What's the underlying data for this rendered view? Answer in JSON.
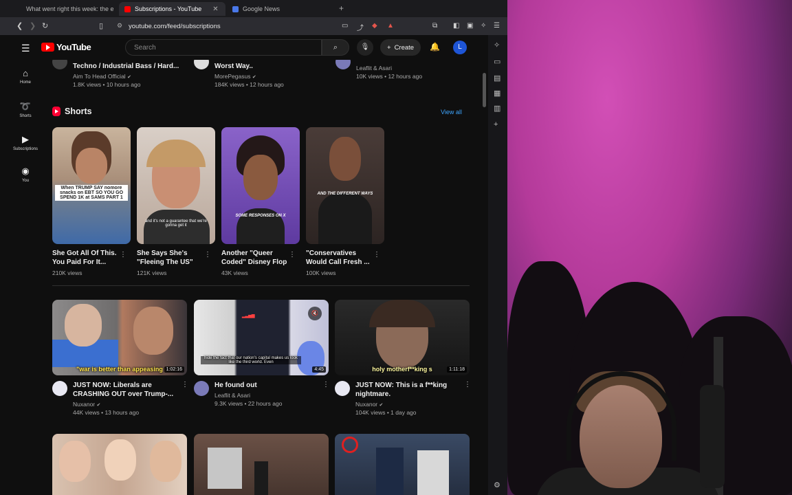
{
  "tabs": [
    {
      "label": "What went right this week: the e",
      "active": false
    },
    {
      "label": "Subscriptions - YouTube",
      "active": true
    },
    {
      "label": "Google News",
      "active": false
    }
  ],
  "address": {
    "url": "youtube.com/feed/subscriptions"
  },
  "youtube": {
    "logo_text": "YouTube",
    "search_placeholder": "Search",
    "create_label": "Create",
    "avatar_letter": "L",
    "guide": [
      {
        "label": "Home",
        "icon": "home-icon"
      },
      {
        "label": "Shorts",
        "icon": "shorts-icon"
      },
      {
        "label": "Subscriptions",
        "icon": "subscriptions-icon"
      },
      {
        "label": "You",
        "icon": "you-icon"
      }
    ],
    "top_row": [
      {
        "title": "Techno / Industrial Bass / Hard...",
        "channel": "Aim To Head Official",
        "stats": "1.8K views • 10 hours ago"
      },
      {
        "title": "Worst Way..",
        "channel": "MorePegasus",
        "stats": "184K views • 12 hours ago"
      },
      {
        "title": "",
        "channel": "Leaflit & Asari",
        "stats": "10K views • 12 hours ago"
      }
    ],
    "shorts": {
      "title": "Shorts",
      "view_all": "View all",
      "items": [
        {
          "title": "She Got All Of This. You Paid For It...",
          "views": "210K views",
          "caption": "When TRUMP SAY nomore snacks on EBT SO YOU GO SPEND 1K at SAMS PART 1"
        },
        {
          "title": "She Says She's \"Fleeing The US\"",
          "views": "121K views",
          "caption": "and it's not a guarantee that we're gonna get it"
        },
        {
          "title": "Another \"Queer Coded\" Disney Flop",
          "views": "43K views",
          "caption": "SOME RESPONSES ON X"
        },
        {
          "title": "\"Conservatives Would Call Fresh ...",
          "views": "100K views",
          "caption": "AND THE DIFFERENT WAYS"
        }
      ]
    },
    "videos": [
      {
        "title": "JUST NOW: Liberals are CRASHING OUT over Trump-...",
        "channel": "Nuxanor",
        "stats": "44K views • 13 hours ago",
        "duration": "1:02:16",
        "subtitle": "\"war is better than appeasing"
      },
      {
        "title": "He found out",
        "channel": "Leaflit & Asari",
        "stats": "9.3K views • 22 hours ago",
        "duration": "4:45",
        "subtitle": "hide the fact that our nation's capital makes us look like the third world. Even"
      },
      {
        "title": "JUST NOW: This is a f**king nightmare.",
        "channel": "Nuxanor",
        "stats": "104K views • 1 day ago",
        "duration": "1:11:18",
        "subtitle": "holy motherf**king s"
      }
    ]
  },
  "colors": {
    "accent_red": "#ff0000",
    "link_blue": "#3ea6ff",
    "avatar_blue": "#1e55d6"
  }
}
